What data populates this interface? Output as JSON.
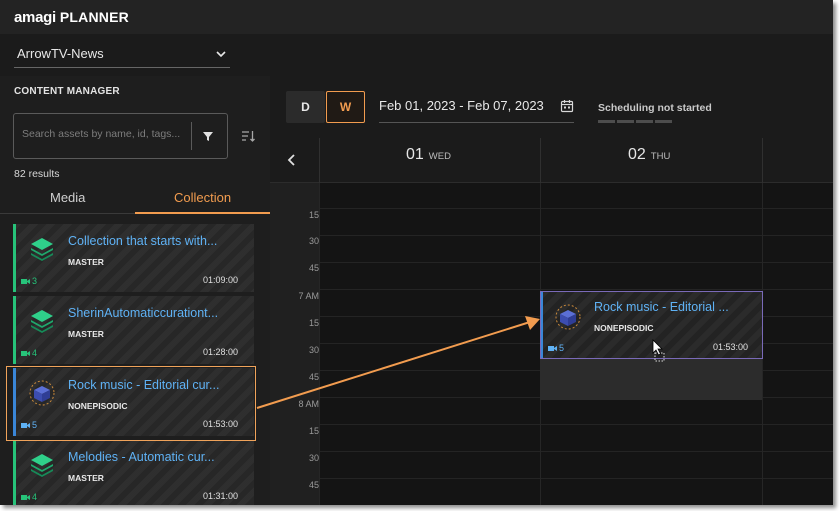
{
  "app": {
    "brand": "amagi",
    "product": "PLANNER"
  },
  "channel": {
    "selected": "ArrowTV-News"
  },
  "content_manager": {
    "title": "CONTENT MANAGER",
    "search_placeholder": "Search assets by name, id, tags...",
    "results": "82 results",
    "tabs": [
      {
        "label": "Media"
      },
      {
        "label": "Collection",
        "active": true
      }
    ],
    "items": [
      {
        "title": "Collection that starts with...",
        "type": "MASTER",
        "count": "3",
        "duration": "01:09:00",
        "thumb": "stack-layers-icon",
        "accent": "#27c37a"
      },
      {
        "title": "SherinAutomaticcurationt...",
        "type": "MASTER",
        "count": "4",
        "duration": "01:28:00",
        "thumb": "stack-layers-icon",
        "accent": "#27c37a"
      },
      {
        "title": "Rock music - Editorial cur...",
        "type": "NONEPISODIC",
        "count": "5",
        "duration": "01:53:00",
        "thumb": "cube-grid-icon",
        "accent": "#3a86d8"
      },
      {
        "title": "Melodies - Automatic cur...",
        "type": "MASTER",
        "count": "4",
        "duration": "01:31:00",
        "thumb": "stack-layers-icon",
        "accent": "#27c37a"
      }
    ]
  },
  "toolbar": {
    "view_day": "D",
    "view_week": "W",
    "date_range": "Feb 01, 2023 - Feb 07, 2023",
    "status": "Scheduling not started"
  },
  "calendar": {
    "days": [
      {
        "num": "01",
        "name": "WED"
      },
      {
        "num": "02",
        "name": "THU"
      }
    ],
    "time_labels": [
      "15",
      "30",
      "45",
      "7 AM",
      "15",
      "30",
      "45",
      "8 AM",
      "15",
      "30",
      "45"
    ],
    "event": {
      "title": "Rock music - Editorial ...",
      "type": "NONEPISODIC",
      "count": "5",
      "duration": "01:53:00"
    }
  },
  "colors": {
    "accent": "#f29c4f",
    "link_blue": "#5fb2f5",
    "green": "#27c37a",
    "event_border": "#7a6ab8"
  }
}
